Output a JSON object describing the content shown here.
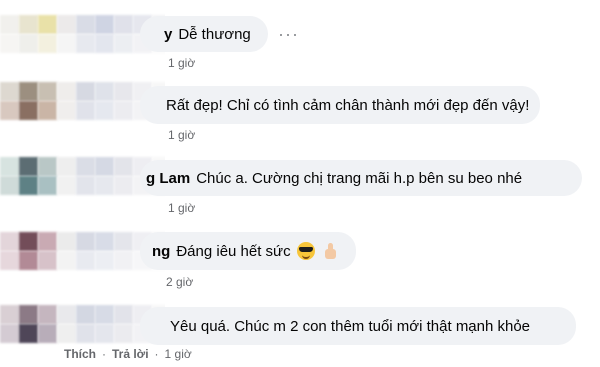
{
  "comments": [
    {
      "name_fragment": "y",
      "text": "Dễ thương",
      "time": "1 giờ",
      "more": "···"
    },
    {
      "name_fragment": "",
      "text": "Rất đẹp! Chỉ có tình cảm chân thành mới đẹp đến vậy!",
      "time": "1 giờ"
    },
    {
      "name_fragment": "g Lam",
      "text": "Chúc a. Cường chị trang mãi h.p bên su beo nhé",
      "time": "1 giờ"
    },
    {
      "name_fragment": "ng",
      "text": "Đáng iêu hết sức",
      "time": "2 giờ",
      "emojis": [
        "sunglasses-face",
        "thumbs-up"
      ]
    },
    {
      "name_fragment": "",
      "text": "Yêu quá. Chúc m 2 con thêm tuổi mới thật mạnh khỏe",
      "time": "1 giờ",
      "actions": [
        "Thích",
        "Trả lời"
      ]
    }
  ],
  "colors": {
    "bubble_bg": "#f0f2f5",
    "meta_text": "#65676b",
    "text": "#050505"
  }
}
